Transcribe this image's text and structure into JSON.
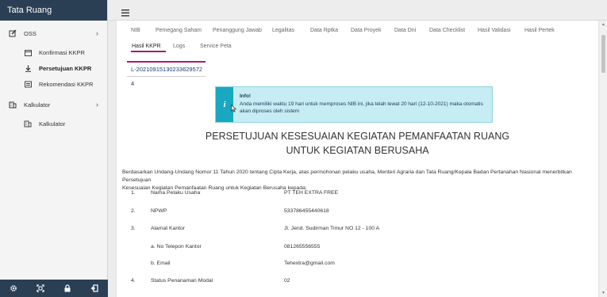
{
  "app": {
    "title": "Tata Ruang"
  },
  "sidebar": {
    "items": [
      {
        "label": "OSS",
        "icon": "edit-icon"
      },
      {
        "label": "Konfirmasi KKPR",
        "icon": "calendar-icon"
      },
      {
        "label": "Persetujuan KKPR",
        "icon": "download-icon",
        "active": true
      },
      {
        "label": "Rekomendasi KKPR",
        "icon": "list-icon"
      },
      {
        "label": "Kalkulator",
        "icon": "building-icon"
      },
      {
        "label": "Kalkulator",
        "icon": "building-icon"
      }
    ],
    "footer_icons": [
      "gear-icon",
      "fullscreen-icon",
      "lock-icon",
      "logout-icon"
    ]
  },
  "tabs": [
    "NIB",
    "Pemegang Saham",
    "Penanggung Jawab",
    "Legalitas",
    "Data Rptka",
    "Data Proyek",
    "Data Dni",
    "Data Checklist",
    "Hasil Validasi",
    "Hasil Pertek",
    "Hasil KKPR",
    "Logs",
    "Service Peta"
  ],
  "subtab": {
    "label": "L-20210915130233629572 4"
  },
  "alert": {
    "title": "Info!",
    "line1": "Anda memiliki waktu 19 hari untuk memproses NIB ini, jika telah lewat 20 hari (12-10-2021) maka otomatis",
    "line2": "akan diproses oleh sistem"
  },
  "document": {
    "title1": "PERSETUJUAN KESESUAIAN KEGIATAN PEMANFAATAN RUANG",
    "title2": "UNTUK KEGIATAN BERUSAHA",
    "intro1": "Berdasarkan Undang-Undang Nomor 11 Tahun 2020 tentang Cipta Kerja, atas permohonan pelaku usaha, Menteri Agraria dan Tata Ruang/Kepala Badan Pertanahan Nasional menerbitkan Persetujuan",
    "intro2": "Kesesuaian Kegiatan Pemanfaatan Ruang untuk Kegiatan Berusaha kepada:",
    "rows": [
      {
        "no": "1.",
        "label": "Nama Pelaku Usaha",
        "value": "PT TEH EXTRA FREE"
      },
      {
        "no": "2.",
        "label": "NPWP",
        "value": "533786455440618"
      },
      {
        "no": "3.",
        "label": "Alamat Kantor",
        "value": "Jl. Jend. Sudirman Timur NO 12 - 100 A"
      },
      {
        "no": "",
        "label": "a. No Telepon Kantor",
        "value": "081265556555"
      },
      {
        "no": "",
        "label": "b. Email",
        "value": "Tehextra@gmail.com"
      },
      {
        "no": "4.",
        "label": "Status Penanaman Modal",
        "value": "02"
      }
    ]
  }
}
